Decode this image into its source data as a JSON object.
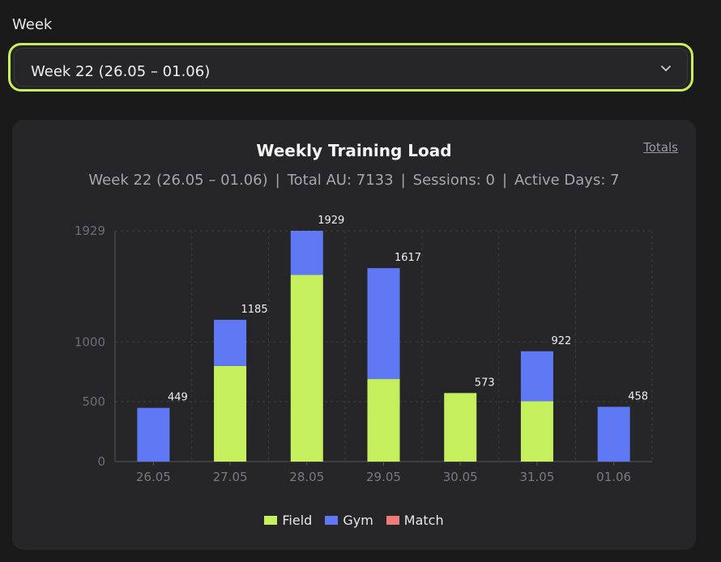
{
  "week_selector": {
    "label": "Week",
    "selected": "Week 22 (26.05 – 01.06)"
  },
  "card": {
    "totals_link": "Totals"
  },
  "summary": {
    "week": "Week 22 (26.05 – 01.06)",
    "total": "Total AU: 7133",
    "sessions": "Sessions: 0",
    "active_days": "Active Days: 7"
  },
  "colors": {
    "field": "#c6ef5e",
    "gym": "#5f78f4",
    "match": "#ef7b7b",
    "accent": "#c8ef5b"
  },
  "chart_data": {
    "type": "bar",
    "stacked": true,
    "title": "Weekly Training Load",
    "categories": [
      "26.05",
      "27.05",
      "28.05",
      "29.05",
      "30.05",
      "31.05",
      "01.06"
    ],
    "series": [
      {
        "name": "Field",
        "values": [
          0,
          800,
          1560,
          690,
          573,
          505,
          0
        ]
      },
      {
        "name": "Gym",
        "values": [
          449,
          385,
          369,
          927,
          0,
          417,
          458
        ]
      },
      {
        "name": "Match",
        "values": [
          0,
          0,
          0,
          0,
          0,
          0,
          0
        ]
      }
    ],
    "totals": [
      449,
      1185,
      1929,
      1617,
      573,
      922,
      458
    ],
    "yticks": [
      0,
      500,
      1000,
      1929
    ],
    "ylim": [
      0,
      1929
    ],
    "grid": true,
    "legend": "bottom"
  }
}
